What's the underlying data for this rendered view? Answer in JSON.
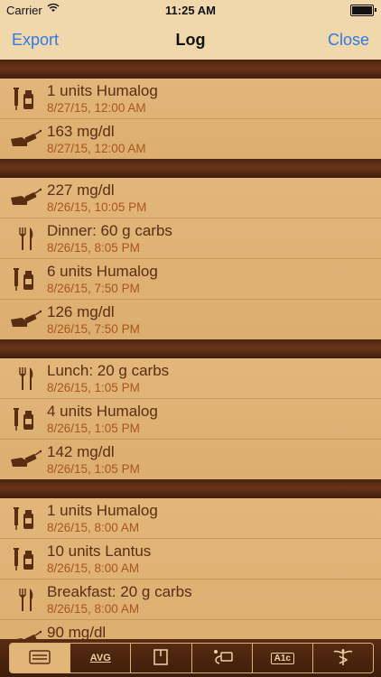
{
  "status_bar": {
    "carrier": "Carrier",
    "time": "11:25 AM"
  },
  "nav": {
    "left": "Export",
    "title": "Log",
    "right": "Close"
  },
  "sections": [
    {
      "rows": [
        {
          "icon": "insulin-icon",
          "main": "1 units Humalog",
          "sub": "8/27/15, 12:00 AM"
        },
        {
          "icon": "glucose-meter-icon",
          "main": "163 mg/dl",
          "sub": "8/27/15, 12:00 AM"
        }
      ]
    },
    {
      "rows": [
        {
          "icon": "glucose-meter-icon",
          "main": "227 mg/dl",
          "sub": "8/26/15, 10:05 PM"
        },
        {
          "icon": "fork-knife-icon",
          "main": "Dinner: 60 g carbs",
          "sub": "8/26/15, 8:05 PM"
        },
        {
          "icon": "insulin-icon",
          "main": "6 units Humalog",
          "sub": "8/26/15, 7:50 PM"
        },
        {
          "icon": "glucose-meter-icon",
          "main": "126 mg/dl",
          "sub": "8/26/15, 7:50 PM"
        }
      ]
    },
    {
      "rows": [
        {
          "icon": "fork-knife-icon",
          "main": "Lunch: 20 g carbs",
          "sub": "8/26/15, 1:05 PM"
        },
        {
          "icon": "insulin-icon",
          "main": "4 units Humalog",
          "sub": "8/26/15, 1:05 PM"
        },
        {
          "icon": "glucose-meter-icon",
          "main": "142 mg/dl",
          "sub": "8/26/15, 1:05 PM"
        }
      ]
    },
    {
      "rows": [
        {
          "icon": "insulin-icon",
          "main": "1 units Humalog",
          "sub": "8/26/15, 8:00 AM"
        },
        {
          "icon": "insulin-icon",
          "main": "10 units Lantus",
          "sub": "8/26/15, 8:00 AM"
        },
        {
          "icon": "fork-knife-icon",
          "main": "Breakfast: 20 g carbs",
          "sub": "8/26/15, 8:00 AM"
        },
        {
          "icon": "glucose-meter-icon",
          "main": "90 mg/dl",
          "sub": ""
        }
      ]
    }
  ],
  "tabs": [
    {
      "icon": "log-list-icon",
      "label": ""
    },
    {
      "icon": "average-icon",
      "label": "AVG"
    },
    {
      "icon": "box-icon",
      "label": ""
    },
    {
      "icon": "meter-device-icon",
      "label": ""
    },
    {
      "icon": "a1c-icon",
      "label": "A1c"
    },
    {
      "icon": "caduceus-icon",
      "label": ""
    }
  ],
  "colors": {
    "accent": "#2e7ae6",
    "primary_text": "#5a2e12",
    "secondary_text": "#a9561d"
  }
}
